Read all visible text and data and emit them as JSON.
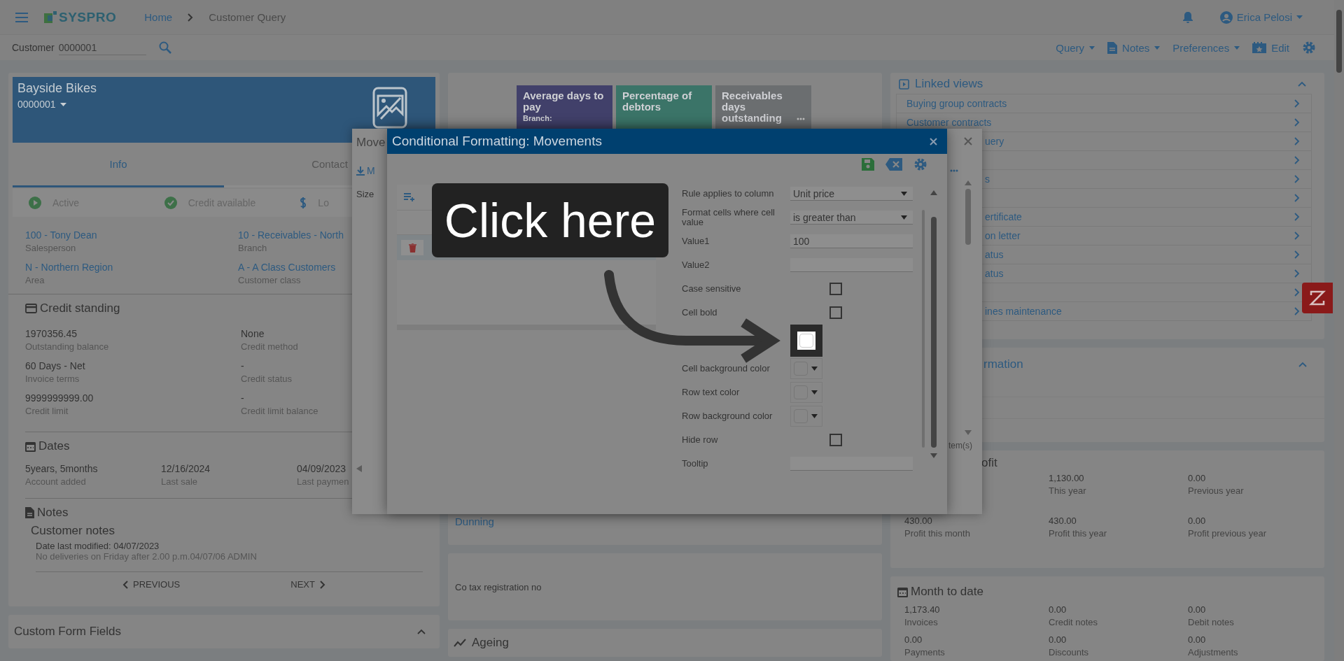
{
  "topbar": {
    "logo": "SYSPRO",
    "breadcrumb": [
      {
        "label": "Home",
        "kind": "link"
      },
      {
        "label": "Customer Query",
        "kind": "current"
      }
    ],
    "user": "Erica Pelosi"
  },
  "toolbar": {
    "customer_label": "Customer",
    "customer_value": "0000001",
    "menus": [
      {
        "label": "Query",
        "kind": "menu"
      },
      {
        "label": "Notes",
        "kind": "notes"
      },
      {
        "label": "Preferences",
        "kind": "menu"
      },
      {
        "label": "Edit",
        "kind": "edit"
      }
    ]
  },
  "customer_card": {
    "name": "Bayside Bikes",
    "code": "0000001",
    "tabs": [
      {
        "label": "Info",
        "selected": true
      },
      {
        "label": "Contact",
        "selected": false
      }
    ],
    "statuses": [
      {
        "label": "Active",
        "kind": "play"
      },
      {
        "label": "Credit available",
        "kind": "check"
      },
      {
        "label": "Lo",
        "kind": "dollar"
      }
    ],
    "links": [
      {
        "value": "100 - Tony Dean",
        "label": "Salesperson"
      },
      {
        "value": "10 - Receivables - North",
        "label": "Branch"
      },
      {
        "value": "N - Northern Region",
        "label": "Area"
      },
      {
        "value": "A - A Class Customers",
        "label": "Customer class"
      }
    ],
    "credit": {
      "title": "Credit standing",
      "fields": [
        {
          "value": "1970356.45",
          "label": "Outstanding balance"
        },
        {
          "value": "None",
          "label": "Credit method"
        },
        {
          "value": "60 Days - Net",
          "label": "Invoice terms"
        },
        {
          "value": "-",
          "label": "Credit status"
        },
        {
          "value": "9999999999.00",
          "label": "Credit limit"
        },
        {
          "value": "-",
          "label": "Credit limit balance"
        }
      ]
    },
    "dates": {
      "title": "Dates",
      "fields": [
        {
          "value": "5years, 5months",
          "label": "Account added"
        },
        {
          "value": "12/16/2024",
          "label": "Last sale"
        },
        {
          "value": "04/09/2023",
          "label": "Last paymen"
        }
      ]
    },
    "notes": {
      "title": "Notes",
      "subtitle": "Customer notes",
      "modified": "Date last modified: 04/07/2023",
      "text": "No deliveries on Friday after 2.00 p.m.04/07/06 ADMIN",
      "previous": "PREVIOUS",
      "next": "NEXT"
    }
  },
  "custom_form_fields": {
    "title": "Custom Form Fields",
    "expanded": true
  },
  "middle": {
    "tiles": [
      {
        "title": "Average days to pay",
        "subtitle": "Branch:",
        "color": "#41406a",
        "more": false
      },
      {
        "title": "Percentage of debtors",
        "color": "#3b7468",
        "more": false
      },
      {
        "title": "Receivables days outstanding",
        "color": "#6b6e70",
        "more": true
      }
    ],
    "dunning": "Dunning",
    "tax_label": "Co tax registration no",
    "ageing": "Ageing"
  },
  "linked_views": {
    "title": "Linked views",
    "expanded": true,
    "items": [
      {
        "label": "Buying group contracts",
        "covered": false
      },
      {
        "label": "Customer contracts",
        "covered": false
      },
      {
        "label": "uery",
        "covered": true
      },
      {
        "covered": true
      },
      {
        "label": "s",
        "covered": true
      },
      {
        "covered": true
      },
      {
        "label": "ertificate",
        "covered": true
      },
      {
        "label": "on letter",
        "covered": true
      },
      {
        "label": "atus",
        "covered": true
      },
      {
        "label": "atus",
        "covered": true
      },
      {
        "covered": true
      },
      {
        "label": "ines maintenance",
        "covered": true
      }
    ]
  },
  "information_card": {
    "title": "rmation",
    "expanded": true
  },
  "profit": {
    "title": "ofit",
    "items": [
      {
        "value": "1,130.00",
        "label": "This year"
      },
      {
        "value": "0.00",
        "label": "Previous year"
      },
      {
        "value": "430.00",
        "label": "Profit this month"
      },
      {
        "value": "430.00",
        "label": "Profit this year"
      },
      {
        "value": "0.00",
        "label": "Profit previous year"
      }
    ]
  },
  "month_to_date": {
    "title": "Month to date",
    "items": [
      {
        "value": "1,173.40",
        "label": "Invoices"
      },
      {
        "value": "0.00",
        "label": "Credit notes"
      },
      {
        "value": "0.00",
        "label": "Debit notes"
      },
      {
        "value": "0.00",
        "label": "Payments"
      },
      {
        "value": "0.00",
        "label": "Discounts"
      },
      {
        "value": "0.00",
        "label": "Adjustments"
      }
    ]
  },
  "movements_dialog": {
    "title": "Move",
    "toolbar_label": "M",
    "column": "Size",
    "footer": "tem(s)"
  },
  "cf_dialog": {
    "title": "Conditional Formatting: Movements",
    "form": [
      {
        "kind": "select",
        "label": "Rule applies to column",
        "value": "Unit price"
      },
      {
        "kind": "select",
        "label": "Format cells where cell value",
        "value": "is greater than"
      },
      {
        "kind": "input",
        "label": "Value1",
        "value": "100"
      },
      {
        "kind": "input",
        "label": "Value2"
      },
      {
        "kind": "checkbox",
        "label": "Case sensitive",
        "checked": false
      },
      {
        "kind": "checkbox",
        "label": "Cell bold",
        "checked": false
      },
      {
        "kind": "color",
        "highlighted": true
      },
      {
        "kind": "color",
        "label": "Cell background color",
        "highlighted": false
      },
      {
        "kind": "color",
        "label": "Row text color",
        "highlighted": false
      },
      {
        "kind": "color",
        "label": "Row background color",
        "highlighted": false
      },
      {
        "kind": "checkbox",
        "label": "Hide row",
        "checked": false
      },
      {
        "kind": "input",
        "label": "Tooltip"
      }
    ]
  },
  "callout": {
    "text": "Click here"
  }
}
